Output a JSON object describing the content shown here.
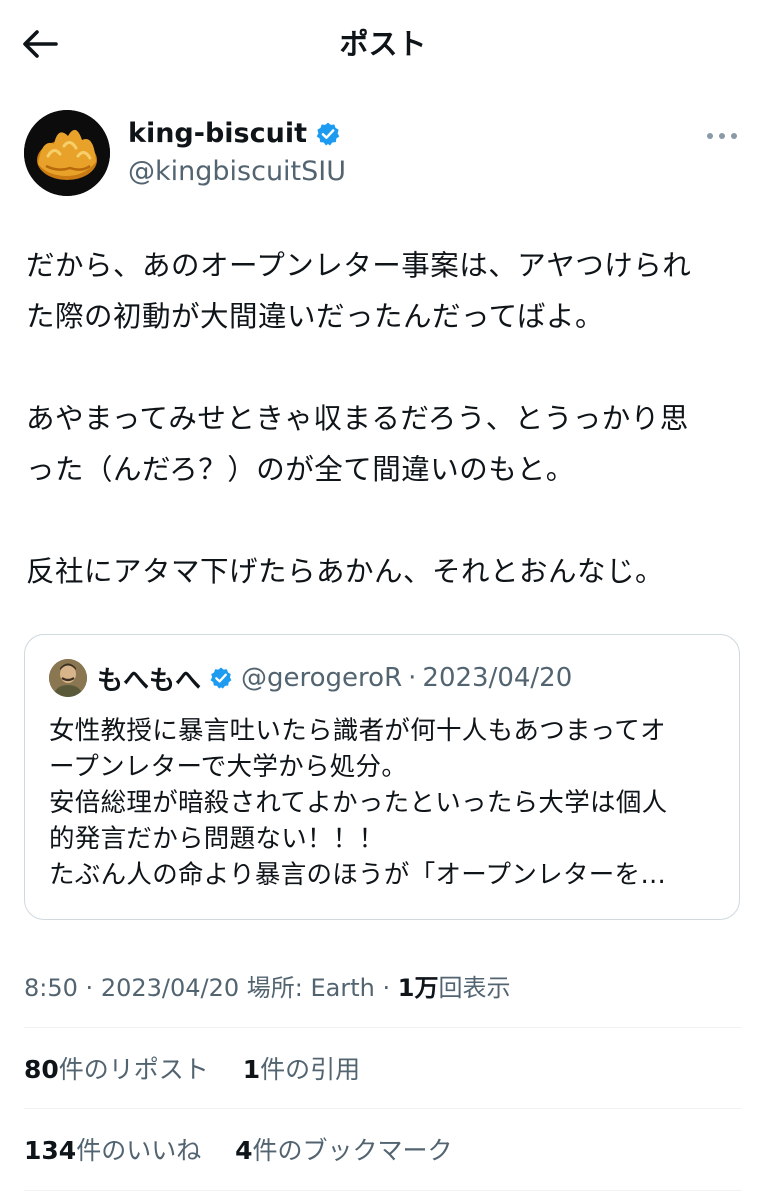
{
  "header": {
    "title": "ポスト",
    "back_icon": "arrow-left-icon"
  },
  "author": {
    "display_name": "king-biscuit",
    "handle": "@kingbiscuitSIU",
    "verified_color": "#1d9bf0"
  },
  "post": {
    "lines": [
      "だから、あのオープンレター事案は、アヤつけられ",
      "た際の初動が大間違いだったんだってばよ。",
      "",
      "あやまってみせときゃ収まるだろう、とうっかり思",
      "った（んだろ？）のが全て間違いのもと。",
      "",
      "反社にアタマ下げたらあかん、それとおんなじ。"
    ]
  },
  "quote": {
    "display_name": "もへもへ",
    "handle": "@gerogeroR",
    "separator": "·",
    "date": "2023/04/20",
    "lines": [
      "女性教授に暴言吐いたら識者が何十人もあつまってオ",
      "ープンレターで大学から処分。",
      "安倍総理が暗殺されてよかったといったら大学は個人",
      "的発言だから問題ない！！！",
      "たぶん人の命より暴言のほうが「オープンレターを…"
    ]
  },
  "meta": {
    "time": "8:50",
    "sep1": "·",
    "date": "2023/04/20",
    "location": "場所: Earth",
    "sep2": "·",
    "views_count": "1万",
    "views_label": "回表示"
  },
  "stats": {
    "reposts_count": "80",
    "reposts_label": "件のリポスト",
    "quotes_count": "1",
    "quotes_label": "件の引用",
    "likes_count": "134",
    "likes_label": "件のいいね",
    "bookmarks_count": "4",
    "bookmarks_label": "件のブックマーク"
  }
}
